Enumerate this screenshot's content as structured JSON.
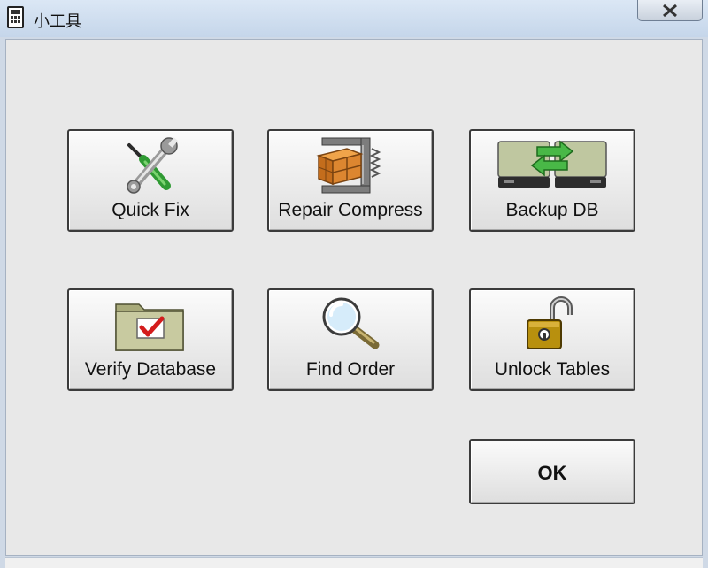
{
  "window": {
    "title": "小工具",
    "close_symbol": "✕"
  },
  "buttons": {
    "quick_fix": {
      "label": "Quick Fix",
      "icon": "tools-icon"
    },
    "repair_compress": {
      "label": "Repair Compress",
      "icon": "clamp-box-icon"
    },
    "backup_db": {
      "label": "Backup DB",
      "icon": "drive-sync-icon"
    },
    "verify_database": {
      "label": "Verify Database",
      "icon": "folder-check-icon"
    },
    "find_order": {
      "label": "Find Order",
      "icon": "magnifier-icon"
    },
    "unlock_tables": {
      "label": "Unlock Tables",
      "icon": "open-padlock-icon"
    },
    "ok": {
      "label": "OK"
    }
  }
}
